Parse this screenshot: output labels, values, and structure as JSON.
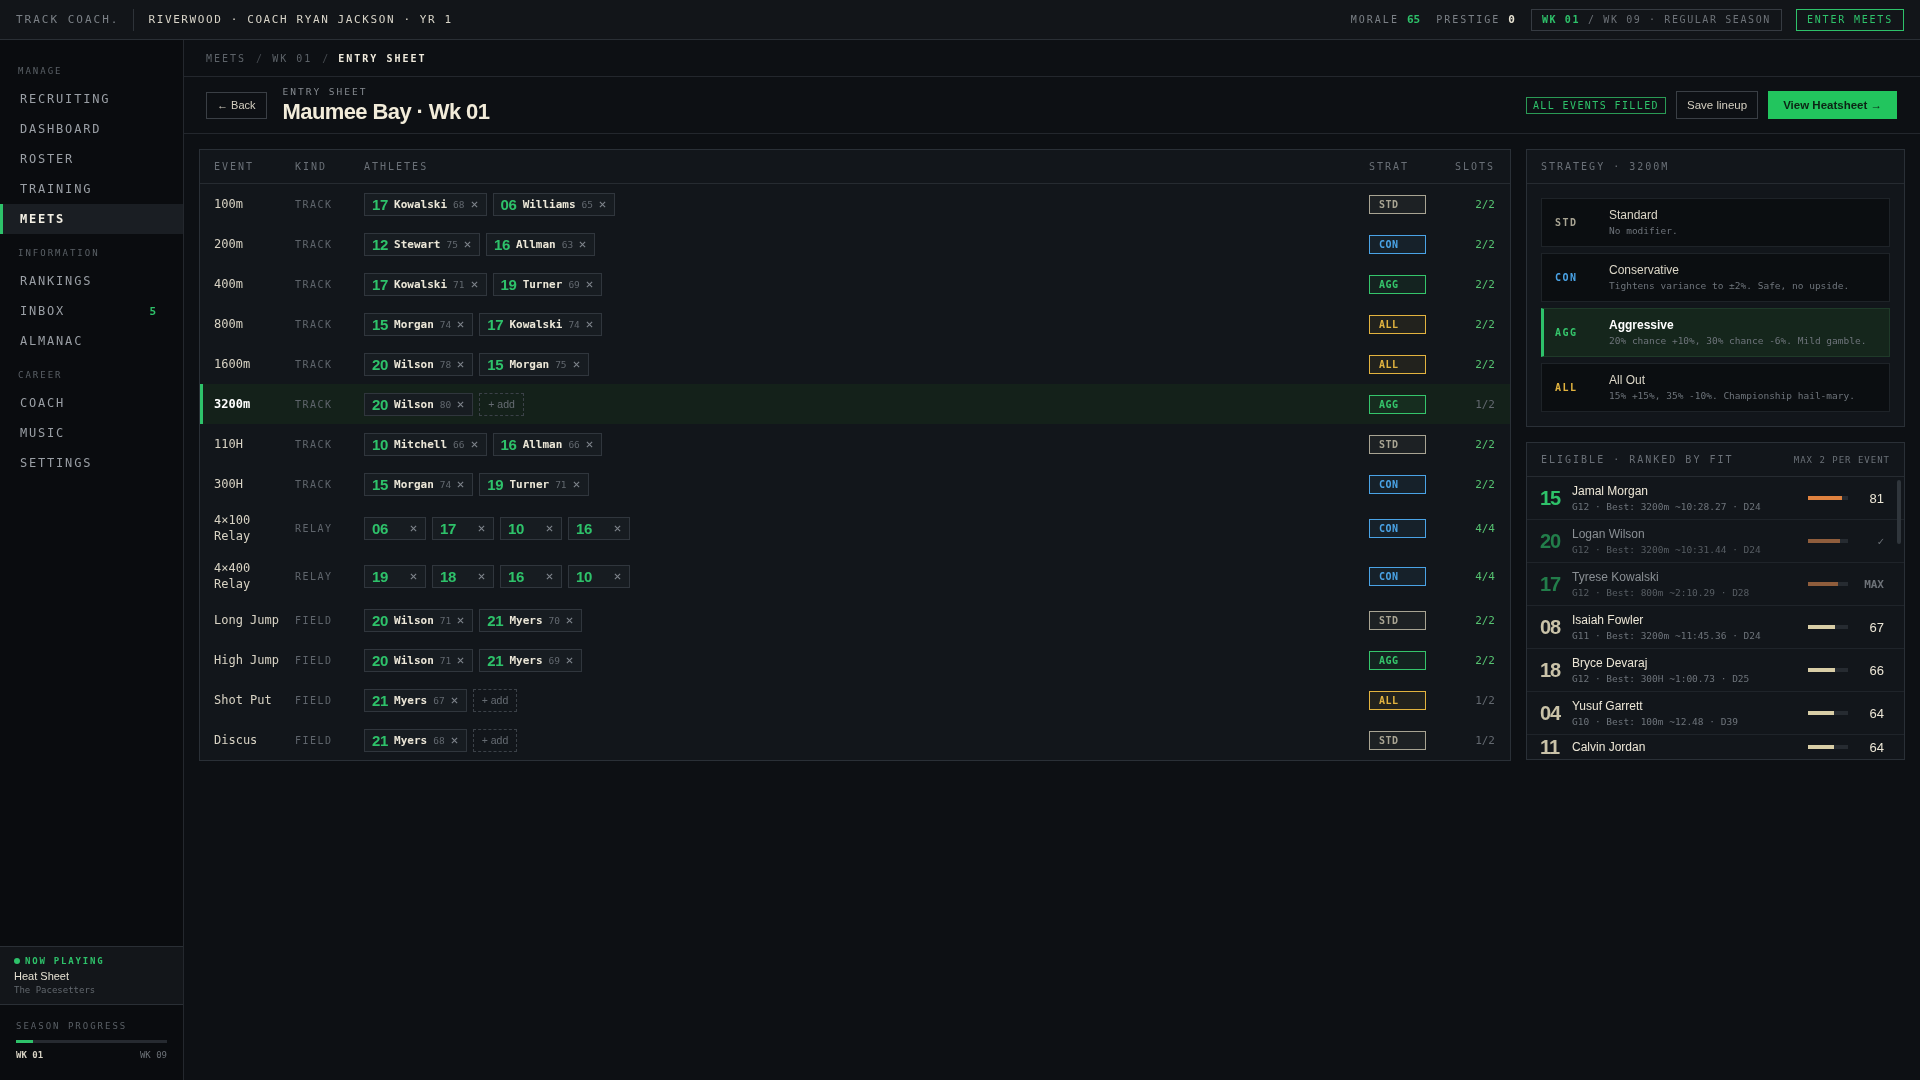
{
  "top_bar": {
    "brand": "TRACK COACH.",
    "context": "RIVERWOOD · COACH RYAN JACKSON · YR 1",
    "stats": [
      {
        "label": "MORALE",
        "value": "65",
        "highlight": true
      },
      {
        "label": "PRESTIGE",
        "value": "0",
        "highlight": false
      }
    ],
    "week": {
      "current": "WK 01",
      "rest": "/ WK 09 · REGULAR SEASON"
    },
    "action": "ENTER MEETS"
  },
  "sidebar": {
    "sections": [
      {
        "title": "MANAGE",
        "items": [
          {
            "label": "RECRUITING",
            "selected": false
          },
          {
            "label": "DASHBOARD",
            "selected": false
          },
          {
            "label": "ROSTER",
            "selected": false
          },
          {
            "label": "TRAINING",
            "selected": false
          },
          {
            "label": "MEETS",
            "selected": true
          }
        ]
      },
      {
        "title": "INFORMATION",
        "items": [
          {
            "label": "RANKINGS",
            "selected": false
          },
          {
            "label": "INBOX",
            "selected": false,
            "count": "5"
          },
          {
            "label": "ALMANAC",
            "selected": false
          }
        ]
      },
      {
        "title": "CAREER",
        "items": [
          {
            "label": "COACH",
            "selected": false
          },
          {
            "label": "MUSIC",
            "selected": false
          },
          {
            "label": "SETTINGS",
            "selected": false
          }
        ]
      }
    ],
    "now_playing": {
      "label": "NOW PLAYING",
      "track": "Heat Sheet",
      "artist": "The Pacesetters"
    },
    "season_progress": {
      "label": "SEASON PROGRESS",
      "level": 0.11,
      "start": "WK 01",
      "end": "WK 09"
    }
  },
  "breadcrumb": {
    "separator": "/",
    "items": [
      {
        "label": "MEETS",
        "current": false
      },
      {
        "label": "WK 01",
        "current": false
      },
      {
        "label": "ENTRY SHEET",
        "current": true
      }
    ]
  },
  "header": {
    "back": "← Back",
    "eyebrow": "ENTRY SHEET",
    "title": "Maumee Bay · Wk 01",
    "status": "ALL EVENTS FILLED",
    "actions": [
      {
        "label": "Save lineup",
        "primary": false
      },
      {
        "label": "View Heatsheet →",
        "primary": true
      }
    ]
  },
  "entry_table": {
    "columns": [
      "EVENT",
      "KIND",
      "ATHLETES",
      "STRAT",
      "SLOTS"
    ],
    "rows": [
      {
        "event": "100m",
        "kind_label": "TRACK",
        "selected": false,
        "athletes": [
          {
            "kind": "athlete",
            "number": "17",
            "name": "Kowalski",
            "rating": "68"
          },
          {
            "kind": "athlete",
            "number": "06",
            "name": "Williams",
            "rating": "65"
          }
        ],
        "strategy": {
          "code": "STD",
          "color": "#a8a493"
        },
        "slots": "2/2",
        "full": true
      },
      {
        "event": "200m",
        "kind_label": "TRACK",
        "selected": false,
        "athletes": [
          {
            "kind": "athlete",
            "number": "12",
            "name": "Stewart",
            "rating": "75"
          },
          {
            "kind": "athlete",
            "number": "16",
            "name": "Allman",
            "rating": "63"
          }
        ],
        "strategy": {
          "code": "CON",
          "color": "#4aa3e6"
        },
        "slots": "2/2",
        "full": true
      },
      {
        "event": "400m",
        "kind_label": "TRACK",
        "selected": false,
        "athletes": [
          {
            "kind": "athlete",
            "number": "17",
            "name": "Kowalski",
            "rating": "71"
          },
          {
            "kind": "athlete",
            "number": "19",
            "name": "Turner",
            "rating": "69"
          }
        ],
        "strategy": {
          "code": "AGG",
          "color": "#35c56b"
        },
        "slots": "2/2",
        "full": true
      },
      {
        "event": "800m",
        "kind_label": "TRACK",
        "selected": false,
        "athletes": [
          {
            "kind": "athlete",
            "number": "15",
            "name": "Morgan",
            "rating": "74"
          },
          {
            "kind": "athlete",
            "number": "17",
            "name": "Kowalski",
            "rating": "74"
          }
        ],
        "strategy": {
          "code": "ALL",
          "color": "#e2b33f"
        },
        "slots": "2/2",
        "full": true
      },
      {
        "event": "1600m",
        "kind_label": "TRACK",
        "selected": false,
        "athletes": [
          {
            "kind": "athlete",
            "number": "20",
            "name": "Wilson",
            "rating": "78"
          },
          {
            "kind": "athlete",
            "number": "15",
            "name": "Morgan",
            "rating": "75"
          }
        ],
        "strategy": {
          "code": "ALL",
          "color": "#e2b33f"
        },
        "slots": "2/2",
        "full": true
      },
      {
        "event": "3200m",
        "kind_label": "TRACK",
        "selected": true,
        "athletes": [
          {
            "kind": "athlete",
            "number": "20",
            "name": "Wilson",
            "rating": "80"
          },
          {
            "kind": "empty",
            "label": "+ add"
          }
        ],
        "strategy": {
          "code": "AGG",
          "color": "#35c56b"
        },
        "slots": "1/2",
        "full": false
      },
      {
        "event": "110H",
        "kind_label": "TRACK",
        "selected": false,
        "athletes": [
          {
            "kind": "athlete",
            "number": "10",
            "name": "Mitchell",
            "rating": "66"
          },
          {
            "kind": "athlete",
            "number": "16",
            "name": "Allman",
            "rating": "66"
          }
        ],
        "strategy": {
          "code": "STD",
          "color": "#a8a493"
        },
        "slots": "2/2",
        "full": true
      },
      {
        "event": "300H",
        "kind_label": "TRACK",
        "selected": false,
        "athletes": [
          {
            "kind": "athlete",
            "number": "15",
            "name": "Morgan",
            "rating": "74"
          },
          {
            "kind": "athlete",
            "number": "19",
            "name": "Turner",
            "rating": "71"
          }
        ],
        "strategy": {
          "code": "CON",
          "color": "#4aa3e6"
        },
        "slots": "2/2",
        "full": true
      },
      {
        "event": "4×100 Relay",
        "kind_label": "RELAY",
        "selected": false,
        "athletes": [
          {
            "kind": "athlete",
            "number": "06"
          },
          {
            "kind": "athlete",
            "number": "17"
          },
          {
            "kind": "athlete",
            "number": "10"
          },
          {
            "kind": "athlete",
            "number": "16"
          }
        ],
        "strategy": {
          "code": "CON",
          "color": "#4aa3e6"
        },
        "slots": "4/4",
        "full": true
      },
      {
        "event": "4×400 Relay",
        "kind_label": "RELAY",
        "selected": false,
        "athletes": [
          {
            "kind": "athlete",
            "number": "19"
          },
          {
            "kind": "athlete",
            "number": "18"
          },
          {
            "kind": "athlete",
            "number": "16"
          },
          {
            "kind": "athlete",
            "number": "10"
          }
        ],
        "strategy": {
          "code": "CON",
          "color": "#4aa3e6"
        },
        "slots": "4/4",
        "full": true
      },
      {
        "event": "Long Jump",
        "kind_label": "FIELD",
        "selected": false,
        "athletes": [
          {
            "kind": "athlete",
            "number": "20",
            "name": "Wilson",
            "rating": "71"
          },
          {
            "kind": "athlete",
            "number": "21",
            "name": "Myers",
            "rating": "70"
          }
        ],
        "strategy": {
          "code": "STD",
          "color": "#a8a493"
        },
        "slots": "2/2",
        "full": true
      },
      {
        "event": "High Jump",
        "kind_label": "FIELD",
        "selected": false,
        "athletes": [
          {
            "kind": "athlete",
            "number": "20",
            "name": "Wilson",
            "rating": "71"
          },
          {
            "kind": "athlete",
            "number": "21",
            "name": "Myers",
            "rating": "69"
          }
        ],
        "strategy": {
          "code": "AGG",
          "color": "#35c56b"
        },
        "slots": "2/2",
        "full": true
      },
      {
        "event": "Shot Put",
        "kind_label": "FIELD",
        "selected": false,
        "athletes": [
          {
            "kind": "athlete",
            "number": "21",
            "name": "Myers",
            "rating": "67"
          },
          {
            "kind": "empty",
            "label": "+ add"
          }
        ],
        "strategy": {
          "code": "ALL",
          "color": "#e2b33f"
        },
        "slots": "1/2",
        "full": false
      },
      {
        "event": "Discus",
        "kind_label": "FIELD",
        "selected": false,
        "athletes": [
          {
            "kind": "athlete",
            "number": "21",
            "name": "Myers",
            "rating": "68"
          },
          {
            "kind": "empty",
            "label": "+ add"
          }
        ],
        "strategy": {
          "code": "STD",
          "color": "#a8a493"
        },
        "slots": "1/2",
        "full": false
      }
    ]
  },
  "strategy": {
    "title": "STRATEGY · 3200M",
    "options": [
      {
        "code": "STD",
        "color": "#a8a493",
        "name": "Standard",
        "description": "No modifier.",
        "selected": false
      },
      {
        "code": "CON",
        "color": "#4aa3e6",
        "name": "Conservative",
        "description": "Tightens variance to ±2%. Safe, no upside.",
        "selected": false
      },
      {
        "code": "AGG",
        "color": "#35c56b",
        "name": "Aggressive",
        "description": "20% chance +10%, 30% chance -6%. Mild gamble.",
        "selected": true
      },
      {
        "code": "ALL",
        "color": "#e2b33f",
        "name": "All Out",
        "description": "15% +15%, 35% -10%. Championship hail-mary.",
        "selected": false
      }
    ]
  },
  "eligible": {
    "title": "ELIGIBLE · RANKED BY FIT",
    "note": "MAX 2 PER EVENT",
    "athletes": [
      {
        "number": "15",
        "name": "Jamal Morgan",
        "detail": "G12 · Best: 3200m ~10:28.27 · D24",
        "level": 0.84,
        "color": "#e0823f",
        "score": "81",
        "dimmed": false,
        "in_lineup": true
      },
      {
        "number": "20",
        "name": "Logan Wilson",
        "detail": "G12 · Best: 3200m ~10:31.44 · D24",
        "level": 0.81,
        "color": "#8f5d3c",
        "score": "✓",
        "dimmed": true,
        "in_lineup": true
      },
      {
        "number": "17",
        "name": "Tyrese Kowalski",
        "detail": "G12 · Best: 800m ~2:10.29 · D28",
        "level": 0.74,
        "color": "#8f5d3c",
        "score": "MAX",
        "dimmed": true,
        "in_lineup": true
      },
      {
        "number": "08",
        "name": "Isaiah Fowler",
        "detail": "G11 · Best: 3200m ~11:45.36 · D24",
        "level": 0.68,
        "color": "#d8cda6",
        "score": "67",
        "dimmed": false,
        "in_lineup": false
      },
      {
        "number": "18",
        "name": "Bryce Devaraj",
        "detail": "G12 · Best: 300H ~1:00.73 · D25",
        "level": 0.68,
        "color": "#d8cda6",
        "score": "66",
        "dimmed": false,
        "in_lineup": false
      },
      {
        "number": "04",
        "name": "Yusuf Garrett",
        "detail": "G10 · Best: 100m ~12.48 · D39",
        "level": 0.66,
        "color": "#d8cda6",
        "score": "64",
        "dimmed": false,
        "in_lineup": false
      },
      {
        "number": "11",
        "name": "Calvin Jordan",
        "level": 0.66,
        "color": "#d8cda6",
        "score": "64",
        "dimmed": false,
        "in_lineup": false
      }
    ]
  }
}
